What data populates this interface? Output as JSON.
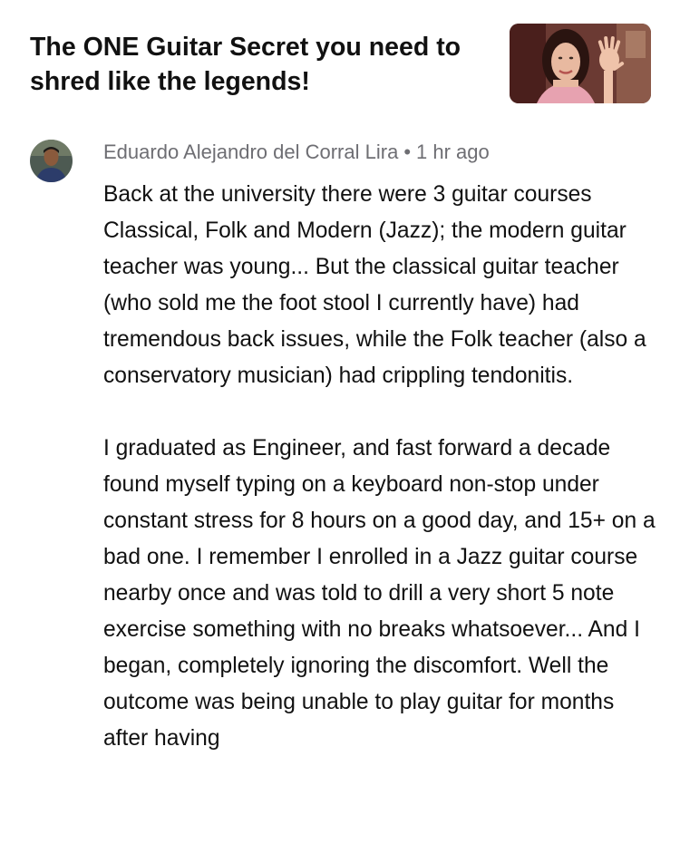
{
  "video": {
    "title": "The ONE Guitar Secret you need to shred like the legends!",
    "thumbnail": "video-thumbnail-woman-waving"
  },
  "comment": {
    "author": "Eduardo Alejandro del Corral Lira",
    "separator": "•",
    "time": "1 hr ago",
    "avatar": "user-avatar-photo",
    "paragraphs": [
      "Back at the university there were 3 guitar courses Classical, Folk and Modern (Jazz); the modern guitar teacher was young... But the classical guitar teacher (who sold me the foot stool I currently have) had tremendous back issues, while the Folk teacher (also a conservatory musician) had crippling tendonitis.",
      "I graduated as Engineer, and fast forward a decade found myself typing on a keyboard non-stop under constant stress for 8 hours on a good day, and 15+ on a bad one. I remember I enrolled in a Jazz guitar course nearby once and was told to drill a very short 5 note exercise something with no breaks whatsoever... And I began, completely ignoring the discomfort. Well the outcome was being unable to play guitar for months after having"
    ]
  }
}
